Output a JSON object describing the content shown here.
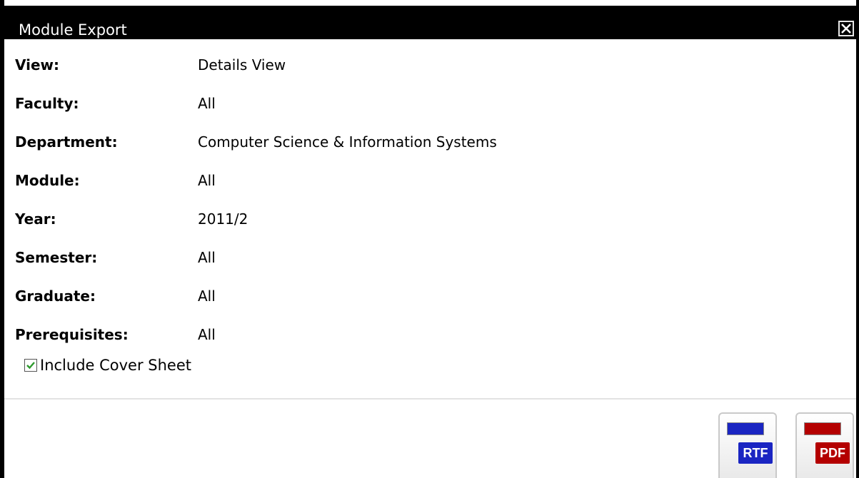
{
  "dialog": {
    "title": "Module Export",
    "close_symbol": "✕"
  },
  "fields": [
    {
      "label": "View:",
      "value": "Details View"
    },
    {
      "label": "Faculty:",
      "value": "All"
    },
    {
      "label": "Department:",
      "value": "Computer Science & Information Systems"
    },
    {
      "label": "Module:",
      "value": "All"
    },
    {
      "label": "Year:",
      "value": "2011/2"
    },
    {
      "label": "Semester:",
      "value": "All"
    },
    {
      "label": "Graduate:",
      "value": "All"
    },
    {
      "label": "Prerequisites:",
      "value": "All"
    }
  ],
  "cover_sheet": {
    "label": "Include Cover Sheet",
    "checked": true
  },
  "export_buttons": {
    "rtf_label": "RTF",
    "pdf_label": "PDF"
  },
  "colors": {
    "rtf_accent": "#1a25c2",
    "pdf_accent": "#b40000",
    "check_color": "#2e9a2e"
  }
}
